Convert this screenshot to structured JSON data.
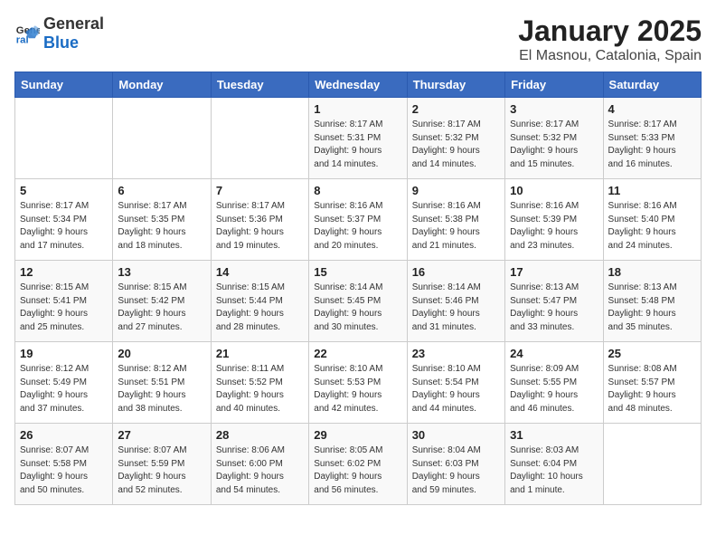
{
  "logo": {
    "general": "General",
    "blue": "Blue"
  },
  "title": "January 2025",
  "subtitle": "El Masnou, Catalonia, Spain",
  "headers": [
    "Sunday",
    "Monday",
    "Tuesday",
    "Wednesday",
    "Thursday",
    "Friday",
    "Saturday"
  ],
  "weeks": [
    [
      {
        "day": "",
        "text": ""
      },
      {
        "day": "",
        "text": ""
      },
      {
        "day": "",
        "text": ""
      },
      {
        "day": "1",
        "text": "Sunrise: 8:17 AM\nSunset: 5:31 PM\nDaylight: 9 hours\nand 14 minutes."
      },
      {
        "day": "2",
        "text": "Sunrise: 8:17 AM\nSunset: 5:32 PM\nDaylight: 9 hours\nand 14 minutes."
      },
      {
        "day": "3",
        "text": "Sunrise: 8:17 AM\nSunset: 5:32 PM\nDaylight: 9 hours\nand 15 minutes."
      },
      {
        "day": "4",
        "text": "Sunrise: 8:17 AM\nSunset: 5:33 PM\nDaylight: 9 hours\nand 16 minutes."
      }
    ],
    [
      {
        "day": "5",
        "text": "Sunrise: 8:17 AM\nSunset: 5:34 PM\nDaylight: 9 hours\nand 17 minutes."
      },
      {
        "day": "6",
        "text": "Sunrise: 8:17 AM\nSunset: 5:35 PM\nDaylight: 9 hours\nand 18 minutes."
      },
      {
        "day": "7",
        "text": "Sunrise: 8:17 AM\nSunset: 5:36 PM\nDaylight: 9 hours\nand 19 minutes."
      },
      {
        "day": "8",
        "text": "Sunrise: 8:16 AM\nSunset: 5:37 PM\nDaylight: 9 hours\nand 20 minutes."
      },
      {
        "day": "9",
        "text": "Sunrise: 8:16 AM\nSunset: 5:38 PM\nDaylight: 9 hours\nand 21 minutes."
      },
      {
        "day": "10",
        "text": "Sunrise: 8:16 AM\nSunset: 5:39 PM\nDaylight: 9 hours\nand 23 minutes."
      },
      {
        "day": "11",
        "text": "Sunrise: 8:16 AM\nSunset: 5:40 PM\nDaylight: 9 hours\nand 24 minutes."
      }
    ],
    [
      {
        "day": "12",
        "text": "Sunrise: 8:15 AM\nSunset: 5:41 PM\nDaylight: 9 hours\nand 25 minutes."
      },
      {
        "day": "13",
        "text": "Sunrise: 8:15 AM\nSunset: 5:42 PM\nDaylight: 9 hours\nand 27 minutes."
      },
      {
        "day": "14",
        "text": "Sunrise: 8:15 AM\nSunset: 5:44 PM\nDaylight: 9 hours\nand 28 minutes."
      },
      {
        "day": "15",
        "text": "Sunrise: 8:14 AM\nSunset: 5:45 PM\nDaylight: 9 hours\nand 30 minutes."
      },
      {
        "day": "16",
        "text": "Sunrise: 8:14 AM\nSunset: 5:46 PM\nDaylight: 9 hours\nand 31 minutes."
      },
      {
        "day": "17",
        "text": "Sunrise: 8:13 AM\nSunset: 5:47 PM\nDaylight: 9 hours\nand 33 minutes."
      },
      {
        "day": "18",
        "text": "Sunrise: 8:13 AM\nSunset: 5:48 PM\nDaylight: 9 hours\nand 35 minutes."
      }
    ],
    [
      {
        "day": "19",
        "text": "Sunrise: 8:12 AM\nSunset: 5:49 PM\nDaylight: 9 hours\nand 37 minutes."
      },
      {
        "day": "20",
        "text": "Sunrise: 8:12 AM\nSunset: 5:51 PM\nDaylight: 9 hours\nand 38 minutes."
      },
      {
        "day": "21",
        "text": "Sunrise: 8:11 AM\nSunset: 5:52 PM\nDaylight: 9 hours\nand 40 minutes."
      },
      {
        "day": "22",
        "text": "Sunrise: 8:10 AM\nSunset: 5:53 PM\nDaylight: 9 hours\nand 42 minutes."
      },
      {
        "day": "23",
        "text": "Sunrise: 8:10 AM\nSunset: 5:54 PM\nDaylight: 9 hours\nand 44 minutes."
      },
      {
        "day": "24",
        "text": "Sunrise: 8:09 AM\nSunset: 5:55 PM\nDaylight: 9 hours\nand 46 minutes."
      },
      {
        "day": "25",
        "text": "Sunrise: 8:08 AM\nSunset: 5:57 PM\nDaylight: 9 hours\nand 48 minutes."
      }
    ],
    [
      {
        "day": "26",
        "text": "Sunrise: 8:07 AM\nSunset: 5:58 PM\nDaylight: 9 hours\nand 50 minutes."
      },
      {
        "day": "27",
        "text": "Sunrise: 8:07 AM\nSunset: 5:59 PM\nDaylight: 9 hours\nand 52 minutes."
      },
      {
        "day": "28",
        "text": "Sunrise: 8:06 AM\nSunset: 6:00 PM\nDaylight: 9 hours\nand 54 minutes."
      },
      {
        "day": "29",
        "text": "Sunrise: 8:05 AM\nSunset: 6:02 PM\nDaylight: 9 hours\nand 56 minutes."
      },
      {
        "day": "30",
        "text": "Sunrise: 8:04 AM\nSunset: 6:03 PM\nDaylight: 9 hours\nand 59 minutes."
      },
      {
        "day": "31",
        "text": "Sunrise: 8:03 AM\nSunset: 6:04 PM\nDaylight: 10 hours\nand 1 minute."
      },
      {
        "day": "",
        "text": ""
      }
    ]
  ]
}
